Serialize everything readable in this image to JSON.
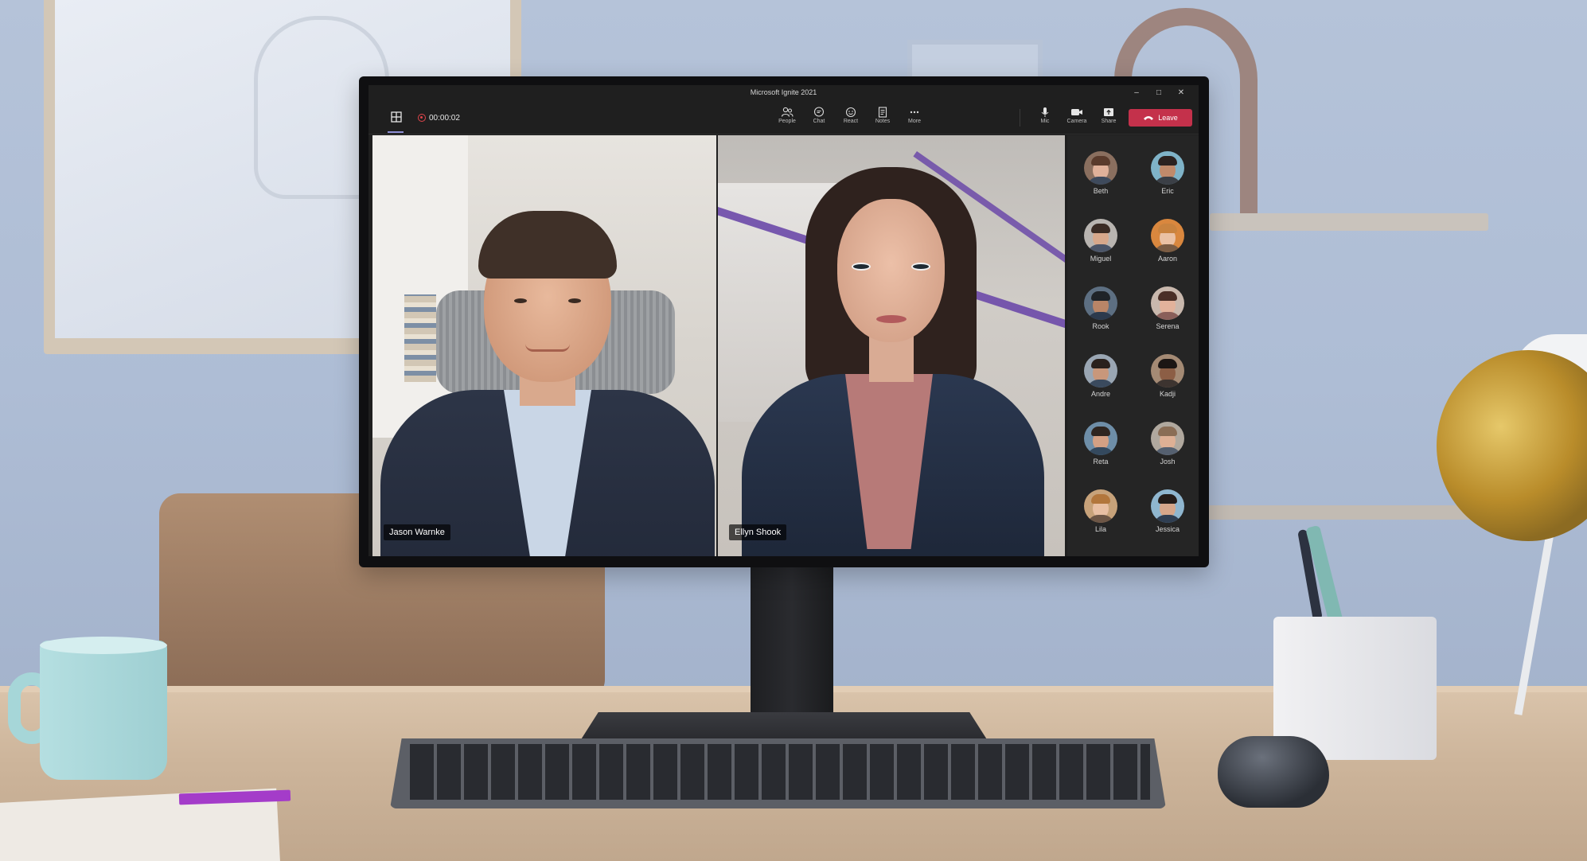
{
  "app": {
    "title": "Microsoft Ignite 2021",
    "timer": "00:00:02"
  },
  "toolbar": {
    "buttons": [
      {
        "label": "People",
        "icon": "people-icon"
      },
      {
        "label": "Chat",
        "icon": "chat-icon"
      },
      {
        "label": "React",
        "icon": "react-icon"
      },
      {
        "label": "Notes",
        "icon": "notes-icon"
      },
      {
        "label": "More",
        "icon": "more-icon"
      },
      {
        "label": "Mic",
        "icon": "mic-icon"
      },
      {
        "label": "Camera",
        "icon": "camera-icon"
      },
      {
        "label": "Share",
        "icon": "share-icon"
      }
    ],
    "leave_label": "Leave"
  },
  "video": {
    "left_name": "Jason Warnke",
    "right_name": "Ellyn Shook"
  },
  "participants": [
    {
      "name": "Beth"
    },
    {
      "name": "Eric"
    },
    {
      "name": "Miguel"
    },
    {
      "name": "Aaron"
    },
    {
      "name": "Rook"
    },
    {
      "name": "Serena"
    },
    {
      "name": "Andre"
    },
    {
      "name": "Kadji"
    },
    {
      "name": "Reta"
    },
    {
      "name": "Josh"
    },
    {
      "name": "Lila"
    },
    {
      "name": "Jessica"
    }
  ],
  "colors": {
    "leave": "#c4314b",
    "accent": "#8f8fd6",
    "recording": "#e0454b"
  }
}
